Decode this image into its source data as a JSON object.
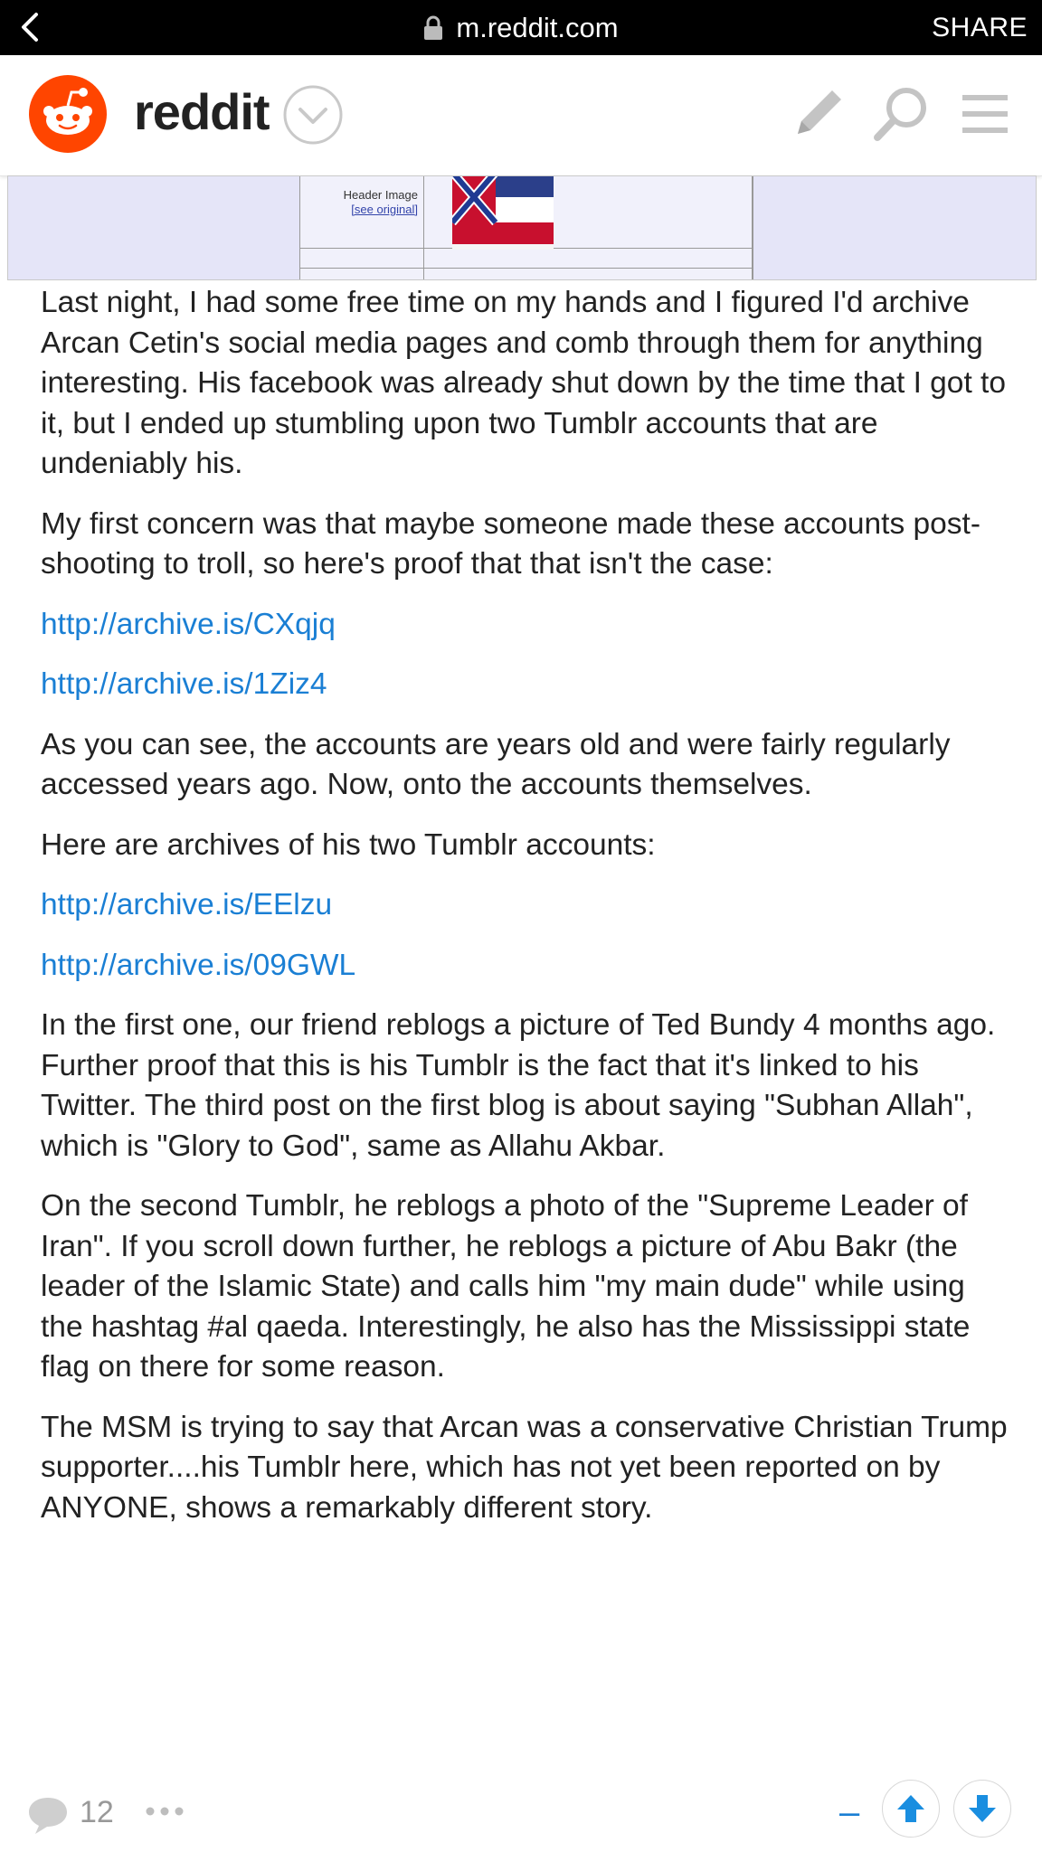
{
  "browser": {
    "url": "m.reddit.com",
    "share_label": "SHARE"
  },
  "header": {
    "wordmark": "reddit"
  },
  "embed": {
    "label_line1": "Header Image",
    "label_line2": "[see original]"
  },
  "post": {
    "paragraphs": [
      "Last night, I had some free time on my hands and I figured I'd archive Arcan Cetin's social media pages and comb through them for anything interesting. His facebook was already shut down by the time that I got to it, but I ended up stumbling upon two Tumblr accounts that are undeniably his.",
      "My first concern was that maybe someone made these accounts post-shooting to troll, so here's proof that that isn't the case:",
      "http://archive.is/CXqjq",
      "http://archive.is/1Ziz4",
      "As you can see, the accounts are years old and were fairly regularly accessed years ago. Now, onto the accounts themselves.",
      "Here are archives of his two Tumblr accounts:",
      "http://archive.is/EElzu",
      "http://archive.is/09GWL",
      "In the first one, our friend reblogs a picture of Ted Bundy 4 months ago. Further proof that this is his Tumblr is the fact that it's linked to his Twitter. The third post on the first blog is about saying \"Subhan Allah\", which is \"Glory to God\", same as Allahu Akbar.",
      "On the second Tumblr, he reblogs a photo of the \"Supreme Leader of Iran\". If you scroll down further, he reblogs a picture of Abu Bakr (the leader of the Islamic State) and calls him \"my main dude\" while using the hashtag #al qaeda. Interestingly, he also has the Mississippi state flag on there for some reason.",
      "The MSM is trying to say that Arcan was a conservative Christian Trump supporter....his Tumblr here, which has not yet been reported on by ANYONE, shows a remarkably different story."
    ]
  },
  "footer": {
    "comment_count": "12",
    "score": "–"
  },
  "colors": {
    "link": "#1a7fd4",
    "reddit_orange": "#ff4500",
    "embed_bg": "#e5e5f8"
  }
}
